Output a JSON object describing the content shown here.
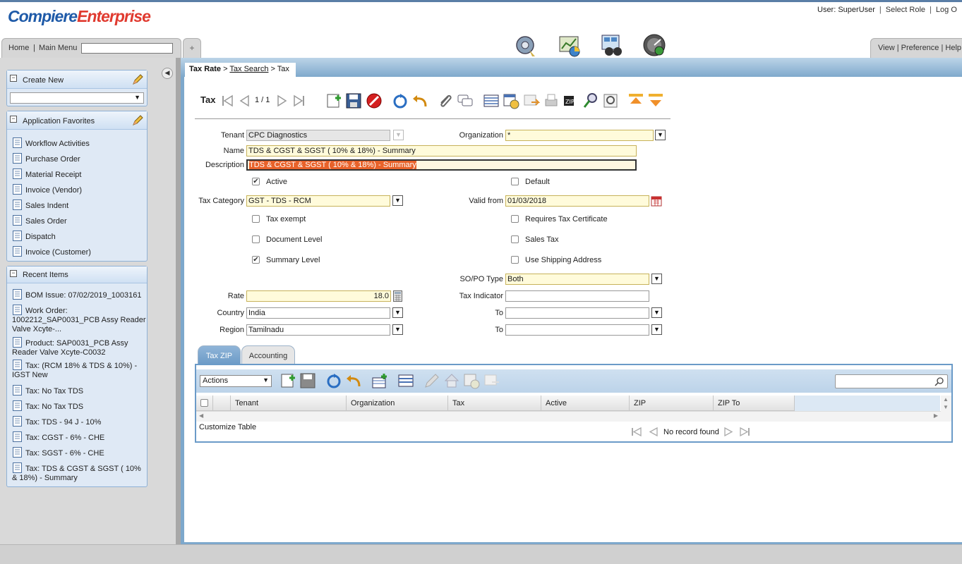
{
  "app": {
    "logo_part1": "Compiere",
    "logo_part2": "Enterprise",
    "user_label": "User: SuperUser",
    "sep": "|",
    "select_role": "Select Role",
    "logout": "Log O"
  },
  "menubar": {
    "home": "Home",
    "sep": "|",
    "main_menu": "Main Menu",
    "search_value": "",
    "plus": "+",
    "view_pref_help": "View | Preference | Help"
  },
  "header_icons": [
    "workflow-gear-icon",
    "monitor-chart-icon",
    "binoculars-icon",
    "gauge-icon"
  ],
  "left": {
    "create_new": {
      "title": "Create New",
      "select_value": ""
    },
    "favorites": {
      "title": "Application Favorites",
      "items": [
        "Workflow Activities",
        "Purchase Order",
        "Material Receipt",
        "Invoice (Vendor)",
        "Sales Indent",
        "Sales Order",
        "Dispatch",
        "Invoice (Customer)"
      ]
    },
    "recent": {
      "title": "Recent Items",
      "items": [
        "BOM Issue: 07/02/2019_1003161",
        "Work Order: 1002212_SAP0031_PCB Assy Reader Valve Xcyte-...",
        "Product: SAP0031_PCB Assy Reader Valve Xcyte-C0032",
        "Tax: (RCM 18% & TDS & 10%) - IGST New",
        "Tax: No Tax TDS",
        "Tax: No Tax TDS",
        "Tax: TDS - 94 J - 10%",
        "Tax: CGST - 6% - CHE",
        "Tax: SGST - 6% - CHE",
        "Tax: TDS & CGST & SGST ( 10% & 18%) - Summary"
      ]
    }
  },
  "breadcrumb": {
    "first": "Tax Rate",
    "gt1": ">",
    "second": "Tax Search",
    "gt2": ">",
    "third": "Tax"
  },
  "toolbar": {
    "window_title": "Tax",
    "record_count": "1 / 1"
  },
  "form": {
    "tenant_label": "Tenant",
    "tenant_value": "CPC Diagnostics",
    "organization_label": "Organization",
    "organization_value": "*",
    "name_label": "Name",
    "name_value": "TDS & CGST & SGST ( 10% & 18%) - Summary",
    "description_label": "Description",
    "description_value": "TDS & CGST & SGST ( 10% & 18%) - Summary",
    "active_label": "Active",
    "default_label": "Default",
    "tax_category_label": "Tax Category",
    "tax_category_value": "GST - TDS - RCM",
    "valid_from_label": "Valid from",
    "valid_from_value": "01/03/2018",
    "tax_exempt_label": "Tax exempt",
    "requires_cert_label": "Requires Tax Certificate",
    "document_level_label": "Document Level",
    "sales_tax_label": "Sales Tax",
    "summary_level_label": "Summary Level",
    "use_shipping_label": "Use Shipping Address",
    "sopo_label": "SO/PO Type",
    "sopo_value": "Both",
    "rate_label": "Rate",
    "rate_value": "18.0",
    "tax_indicator_label": "Tax Indicator",
    "tax_indicator_value": "",
    "country_label": "Country",
    "country_value": "India",
    "to_label": "To",
    "to_country_value": "",
    "region_label": "Region",
    "region_value": "Tamilnadu",
    "to_region_value": ""
  },
  "checkboxes": {
    "active": true,
    "default": false,
    "tax_exempt": false,
    "requires_cert": false,
    "document_level": false,
    "sales_tax": false,
    "summary_level": true,
    "use_shipping": false
  },
  "subtabs": [
    "Tax ZIP",
    "Accounting"
  ],
  "grid": {
    "actions_label": "Actions",
    "columns": [
      "Tenant",
      "Organization",
      "Tax",
      "Active",
      "ZIP",
      "ZIP To"
    ],
    "customize": "Customize Table",
    "no_record": "No record found"
  },
  "colors": {
    "accent_blue": "#6b9bc8",
    "brand_blue": "#1e5aa8",
    "brand_red": "#e03a2f",
    "mandatory_bg": "#fffbdb",
    "selection_orange": "#e8622a"
  }
}
